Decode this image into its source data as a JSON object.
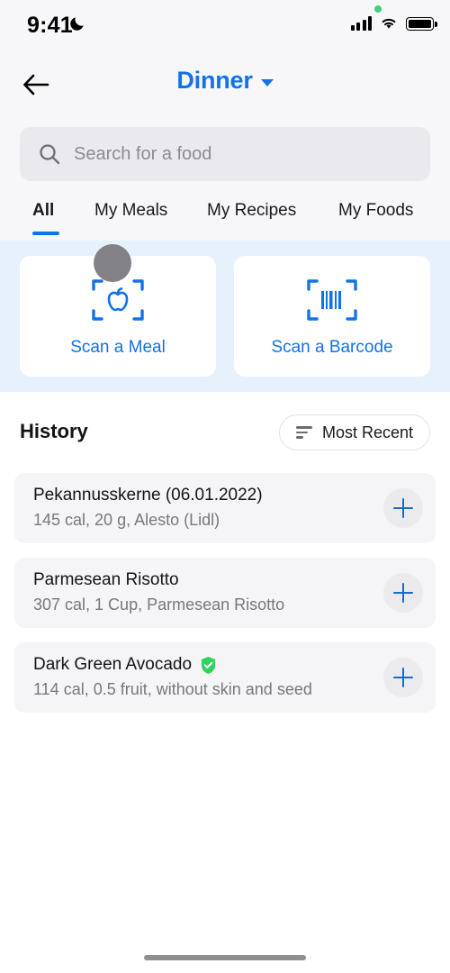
{
  "status_bar": {
    "time": "9:41",
    "dnd_icon": "crescent-moon-icon",
    "signal_icon": "cellular-signal-icon",
    "wifi_icon": "wifi-icon",
    "battery_icon": "battery-icon",
    "privacy_indicator": "green-privacy-dot"
  },
  "nav": {
    "back_icon": "back-arrow-icon",
    "title": "Dinner",
    "chevron_icon": "chevron-down-icon"
  },
  "search": {
    "placeholder": "Search for a food",
    "value": "",
    "icon": "search-icon"
  },
  "tabs": {
    "active_index": 0,
    "items": [
      {
        "label": "All"
      },
      {
        "label": "My Meals"
      },
      {
        "label": "My Recipes"
      },
      {
        "label": "My Foods"
      }
    ]
  },
  "scan": {
    "cards": [
      {
        "label": "Scan a Meal",
        "icon": "scan-apple-icon"
      },
      {
        "label": "Scan a Barcode",
        "icon": "scan-barcode-icon"
      }
    ]
  },
  "history": {
    "title": "History",
    "sort": {
      "label": "Most Recent",
      "icon": "sort-icon"
    },
    "items": [
      {
        "name": "Pekannusskerne (06.01.2022)",
        "details": "145 cal, 20 g, Alesto (Lidl)",
        "verified": false,
        "add_icon": "plus-icon"
      },
      {
        "name": "Parmesean Risotto",
        "details": "307 cal, 1 Cup, Parmesean Risotto",
        "verified": false,
        "add_icon": "plus-icon"
      },
      {
        "name": "Dark Green Avocado",
        "details": "114 cal, 0.5 fruit, without skin and seed",
        "verified": true,
        "verified_icon": "verified-shield-icon",
        "add_icon": "plus-icon"
      }
    ]
  },
  "colors": {
    "accent_blue": "#1272e8",
    "scan_band": "#e7f1fc",
    "row_bg": "#f5f5f7",
    "verified_green": "#2fd35e",
    "page_bg": "#f7f7f9"
  },
  "home_indicator": "home-indicator"
}
